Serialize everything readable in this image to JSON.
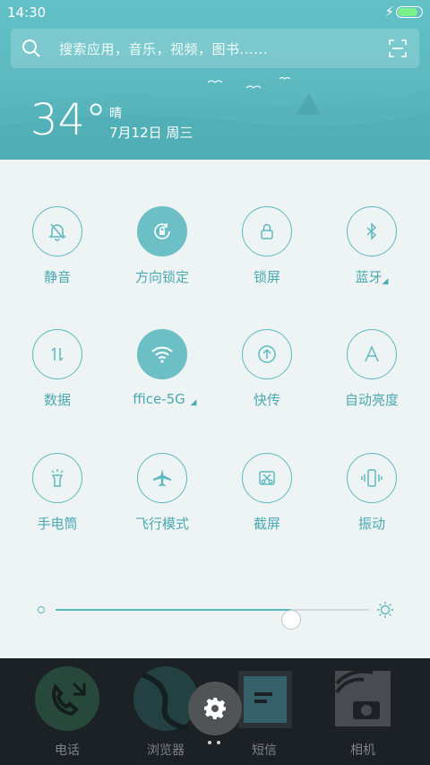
{
  "status_bar": {
    "time": "14:30",
    "battery_level": 0.9,
    "charging_icon": "bolt-icon"
  },
  "search": {
    "placeholder": "搜索应用，音乐，视频，图书......"
  },
  "weather": {
    "temperature": "34°",
    "condition": "晴",
    "date": "7月12日 周三"
  },
  "toggles": [
    {
      "label": "静音",
      "icon": "bell-off-icon",
      "on": false
    },
    {
      "label": "方向锁定",
      "icon": "rotation-lock-icon",
      "on": true
    },
    {
      "label": "锁屏",
      "icon": "lock-icon",
      "on": false
    },
    {
      "label": "蓝牙",
      "icon": "bluetooth-icon",
      "on": false
    },
    {
      "label": "数据",
      "icon": "data-arrows-icon",
      "on": false
    },
    {
      "label": "ffice-5G",
      "icon": "wifi-icon",
      "on": true
    },
    {
      "label": "快传",
      "icon": "upload-icon",
      "on": false
    },
    {
      "label": "自动亮度",
      "icon": "auto-brightness-icon",
      "on": false
    },
    {
      "label": "手电筒",
      "icon": "flashlight-icon",
      "on": false
    },
    {
      "label": "飞行模式",
      "icon": "airplane-icon",
      "on": false
    },
    {
      "label": "截屏",
      "icon": "screenshot-icon",
      "on": false
    },
    {
      "label": "振动",
      "icon": "vibrate-icon",
      "on": false
    }
  ],
  "brightness": {
    "level": 0.75
  },
  "dock": {
    "apps": [
      {
        "label": "电话",
        "icon": "phone-icon"
      },
      {
        "label": "浏览器",
        "icon": "browser-icon"
      },
      {
        "label": "短信",
        "icon": "sms-icon"
      },
      {
        "label": "相机",
        "icon": "camera-icon"
      }
    ]
  },
  "colors": {
    "accent": "#5dbac0",
    "header": "#5bb8bf",
    "panel": "#eef3f4"
  }
}
